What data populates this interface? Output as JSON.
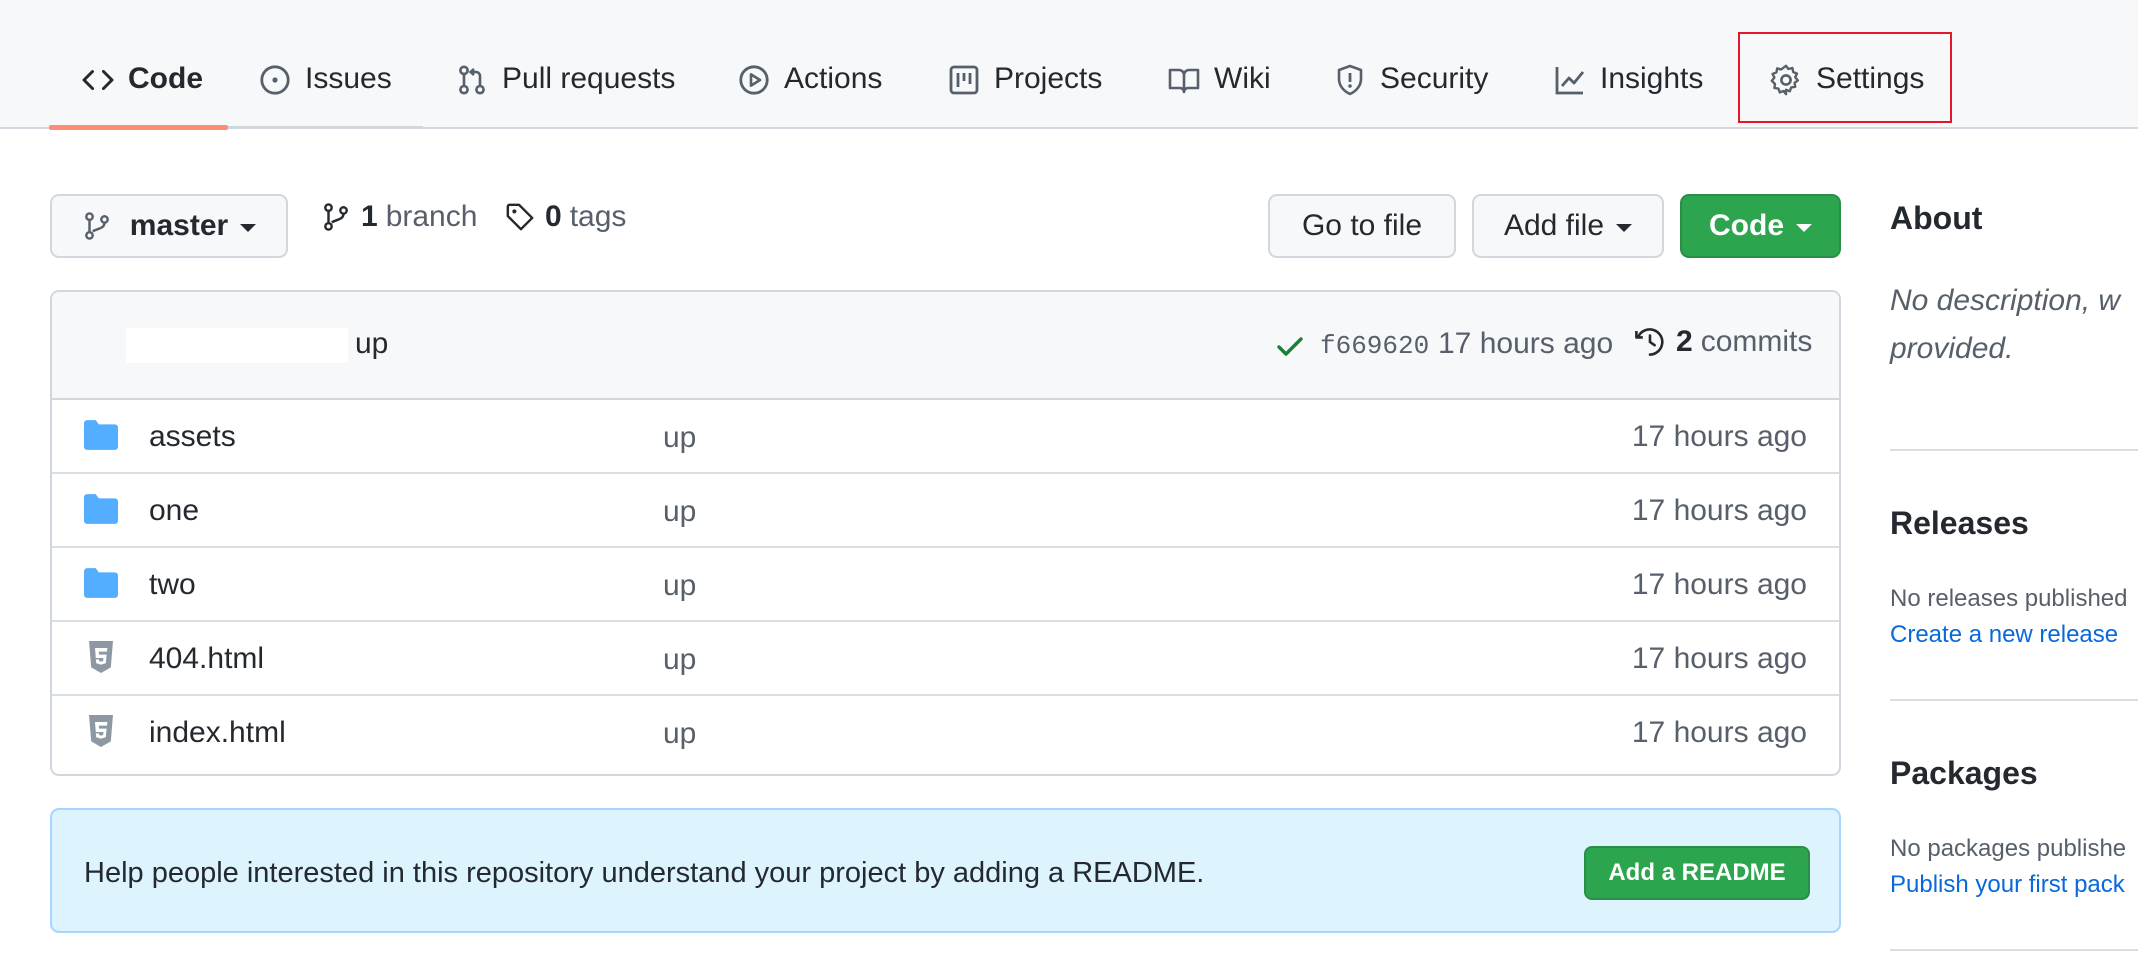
{
  "nav": {
    "tabs": [
      {
        "label": "Code",
        "icon": "code-icon"
      },
      {
        "label": "Issues",
        "icon": "issue-opened-icon"
      },
      {
        "label": "Pull requests",
        "icon": "git-pull-request-icon"
      },
      {
        "label": "Actions",
        "icon": "play-icon"
      },
      {
        "label": "Projects",
        "icon": "project-icon"
      },
      {
        "label": "Wiki",
        "icon": "book-icon"
      },
      {
        "label": "Security",
        "icon": "shield-icon"
      },
      {
        "label": "Insights",
        "icon": "graph-icon"
      },
      {
        "label": "Settings",
        "icon": "gear-icon"
      }
    ],
    "active_tab": "Code",
    "highlighted_tab": "Settings",
    "highlight_color": "#e5172b",
    "active_underline_color": "#fd8c73"
  },
  "repo": {
    "branch_button": "master",
    "branches_count": "1",
    "branches_label": "branch",
    "tags_count": "0",
    "tags_label": "tags",
    "go_to_file": "Go to file",
    "add_file": "Add file",
    "code_button": "Code"
  },
  "latest_commit": {
    "message": "up",
    "status": "success-check",
    "sha": "f669620",
    "time": "17 hours ago",
    "commits_count": "2",
    "commits_label": "commits"
  },
  "files": [
    {
      "name": "assets",
      "type": "folder",
      "message": "up",
      "time": "17 hours ago"
    },
    {
      "name": "one",
      "type": "folder",
      "message": "up",
      "time": "17 hours ago"
    },
    {
      "name": "two",
      "type": "folder",
      "message": "up",
      "time": "17 hours ago"
    },
    {
      "name": "404.html",
      "type": "html-file",
      "message": "up",
      "time": "17 hours ago"
    },
    {
      "name": "index.html",
      "type": "html-file",
      "message": "up",
      "time": "17 hours ago"
    }
  ],
  "readme_banner": {
    "text": "Help people interested in this repository understand your project by adding a README.",
    "button": "Add a README"
  },
  "sidebar": {
    "about_title": "About",
    "about_desc_line1": "No description, w",
    "about_desc_line2": "provided.",
    "releases_title": "Releases",
    "releases_text": "No releases published",
    "releases_link": "Create a new release",
    "packages_title": "Packages",
    "packages_text": "No packages publishe",
    "packages_link": "Publish your first pack"
  },
  "colors": {
    "green_button": "#2da44e",
    "folder": "#54aeff",
    "link": "#0969da",
    "banner_bg": "#ddf4ff"
  }
}
